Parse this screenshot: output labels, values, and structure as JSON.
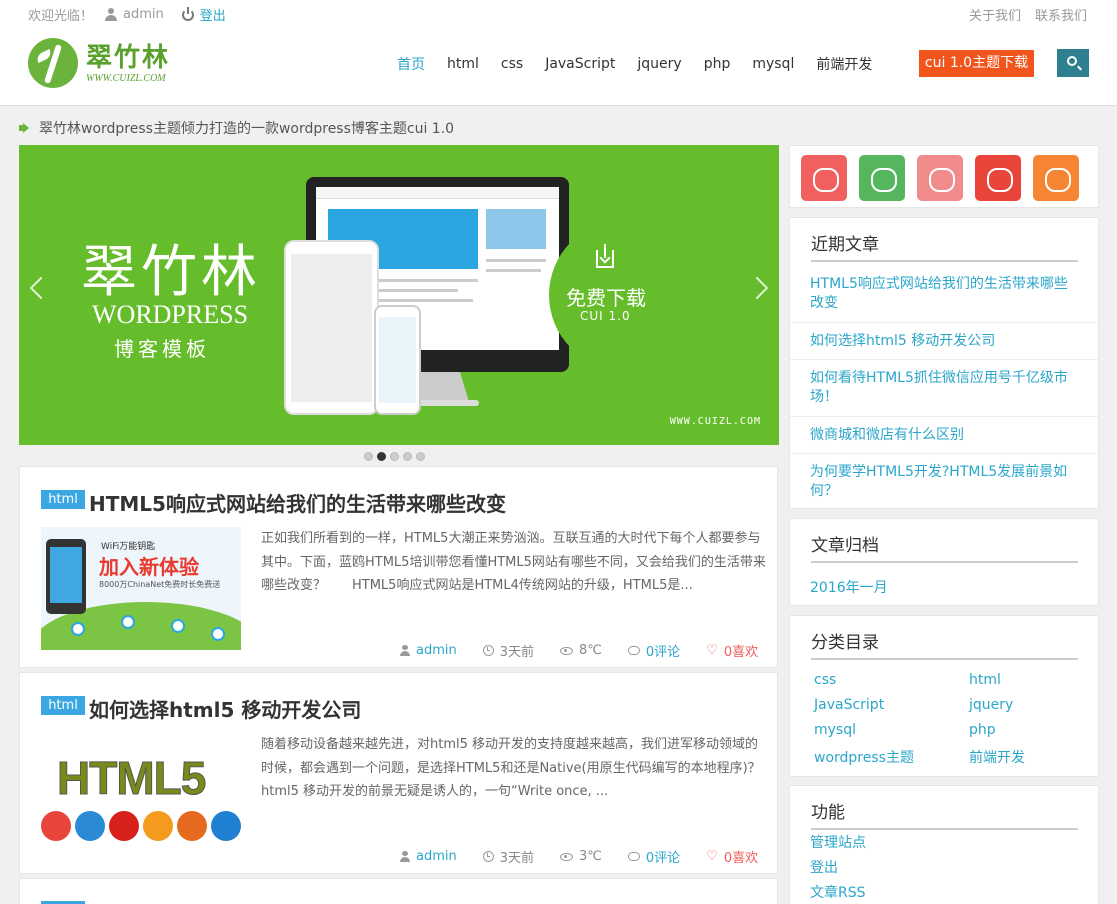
{
  "topbar": {
    "welcome": "欢迎光临！",
    "username": "admin",
    "logout": "登出",
    "about": "关于我们",
    "contact": "联系我们"
  },
  "logo": {
    "cn": "翠竹林",
    "en": "WWW.CUIZL.COM"
  },
  "nav": {
    "items": [
      "首页",
      "html",
      "css",
      "JavaScript",
      "jquery",
      "php",
      "mysql",
      "前端开发"
    ],
    "download": "cui 1.0主题下载",
    "active_color": "#2ba6cb"
  },
  "notice": "翠竹林wordpress主题倾力打造的一款wordpress博客主题cui 1.0",
  "banner": {
    "title": "翠竹林",
    "subtitle": "WORDPRESS",
    "subtitle2": "博客模板",
    "download_text": "免费下载",
    "version": "CUI 1.0",
    "url": "WWW.CUIZL.COM",
    "bg_color": "#66bd2b",
    "dots_total": 5,
    "dots_active": 2
  },
  "posts": [
    {
      "tag": "html",
      "title": "HTML5响应式网站给我们的生活带来哪些改变",
      "excerpt": "正如我们所看到的一样，HTML5大潮正来势汹汹。互联互通的大时代下每个人都要参与其中。下面，蓝鸥HTML5培训带您看懂HTML5网站有哪些不同，又会给我们的生活带来哪些改变？　　HTML5响应式网站是HTML4传统网站的升级，HTML5是...",
      "thumb": {
        "wifi": "WiFi万能钥匙",
        "big": "加入新体验",
        "small": "8000万ChinaNet免费时长免费送"
      },
      "author": "admin",
      "time": "3天前",
      "views": "8℃",
      "comments": "0评论",
      "likes": "0喜欢"
    },
    {
      "tag": "html",
      "title": "如何选择html5 移动开发公司",
      "excerpt": "随着移动设备越来越先进，对html5 移动开发的支持度越来越高，我们进军移动领域的时候，都会遇到一个问题，是选择HTML5和还是Native(用原生代码编写的本地程序)？html5 移动开发的前景无疑是诱人的，一句“Write once, ...",
      "thumb": {
        "text": "HTML5"
      },
      "author": "admin",
      "time": "3天前",
      "views": "3℃",
      "comments": "0评论",
      "likes": "0喜欢"
    }
  ],
  "sidebar": {
    "social_icons": [
      "weibo-icon",
      "wechat-icon",
      "mail-icon",
      "qq-icon",
      "rss-icon"
    ],
    "social_colors": [
      "#f0605f",
      "#56b65e",
      "#f28c8c",
      "#e9453b",
      "#f58532"
    ],
    "recent": {
      "title": "近期文章",
      "items": [
        "HTML5响应式网站给我们的生活带来哪些改变",
        "如何选择html5 移动开发公司",
        "如何看待HTML5抓住微信应用号千亿级市场！",
        "微商城和微店有什么区别",
        "为何要学HTML5开发?HTML5发展前景如何？"
      ]
    },
    "archive": {
      "title": "文章归档",
      "items": [
        "2016年一月"
      ]
    },
    "categories": {
      "title": "分类目录",
      "items": [
        "css",
        "html",
        "JavaScript",
        "jquery",
        "mysql",
        "php",
        "wordpress主题",
        "前端开发"
      ]
    },
    "functions": {
      "title": "功能",
      "items": [
        "管理站点",
        "登出",
        "文章RSS"
      ]
    }
  }
}
